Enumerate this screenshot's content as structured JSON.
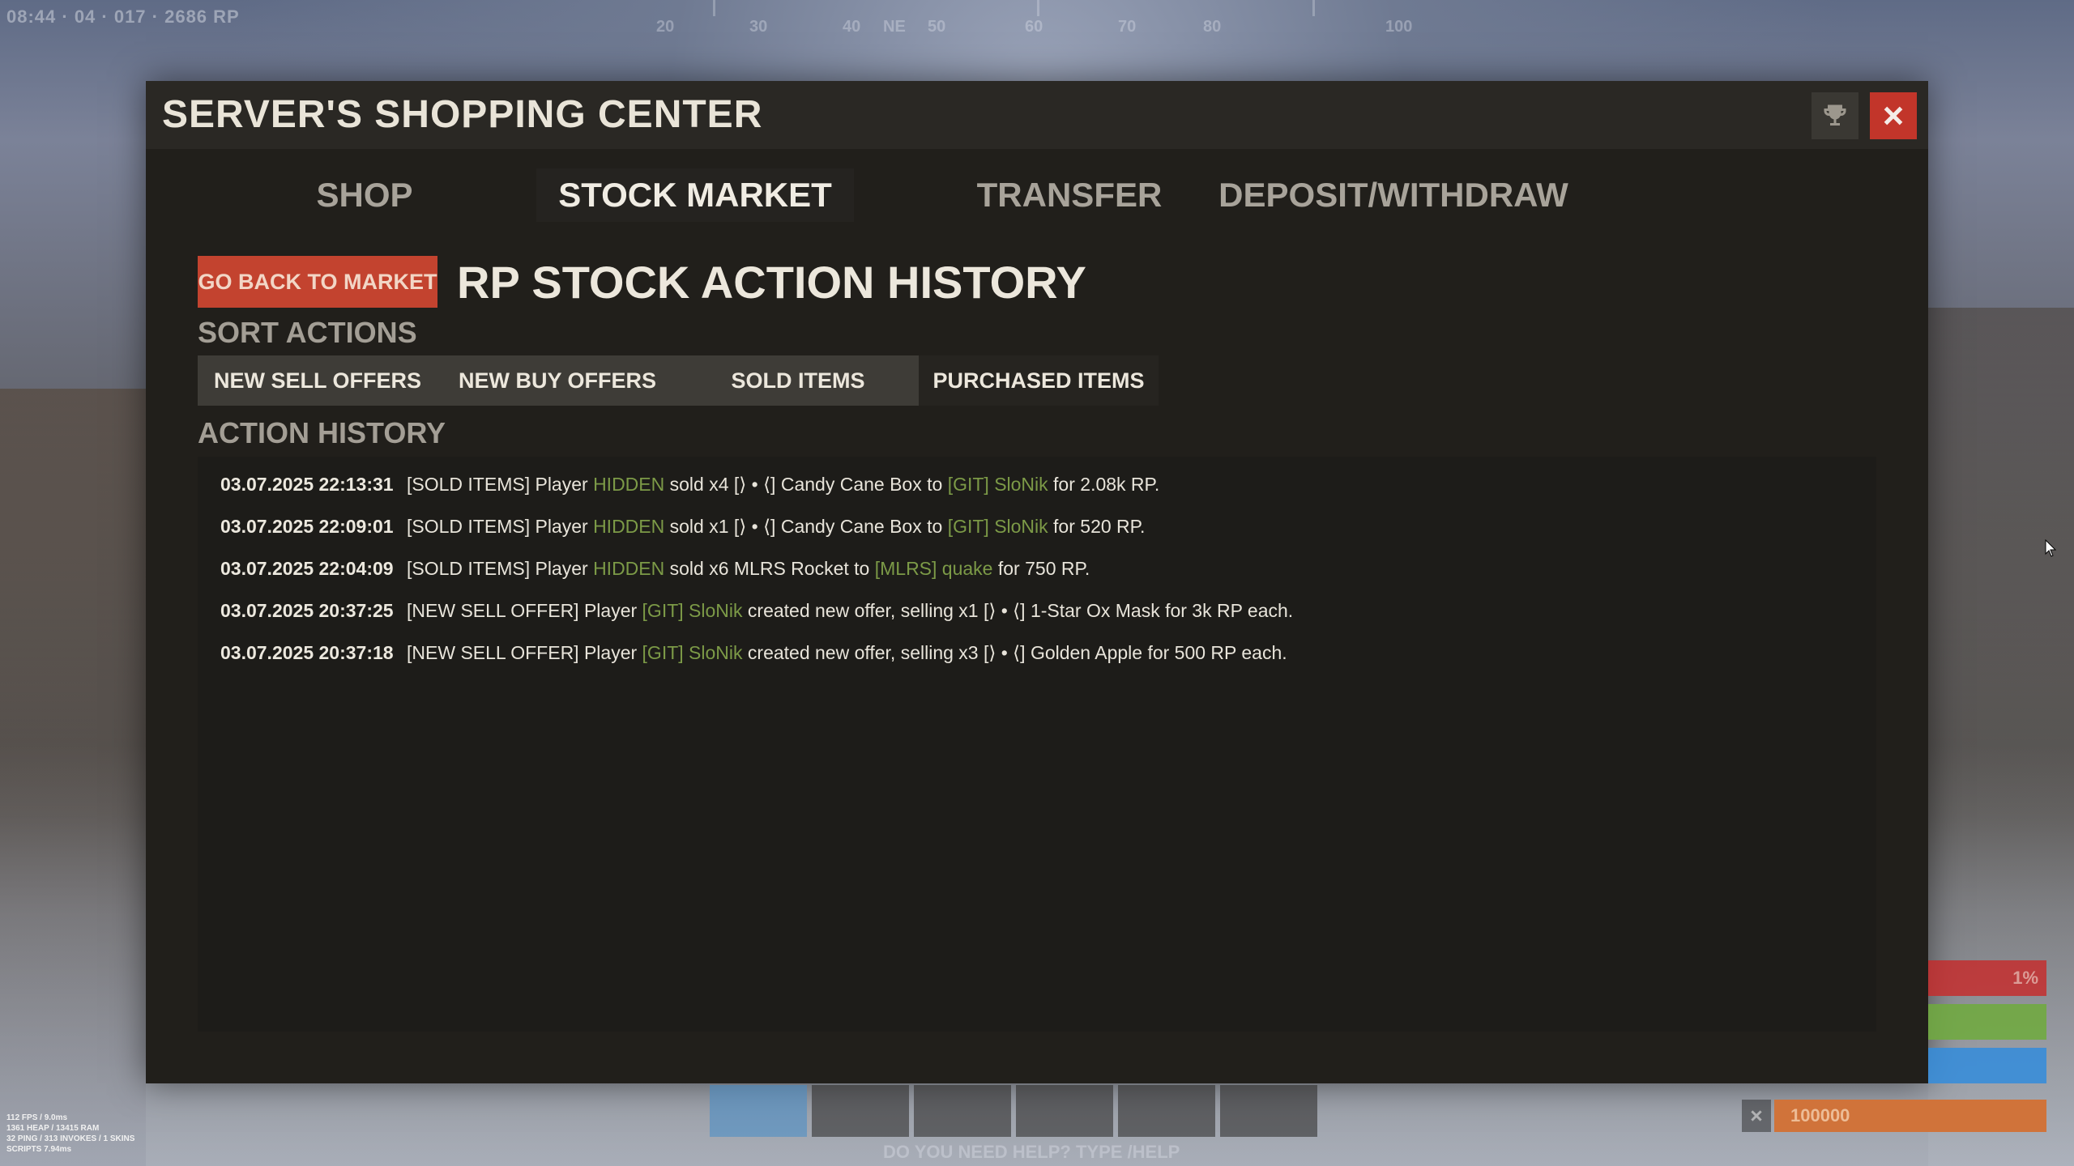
{
  "hud": {
    "top_left": "08:44 · 04 · 017 · 2686 RP",
    "compass": [
      "20",
      "30",
      "40",
      "NE",
      "50",
      "60",
      "70",
      "80",
      "100"
    ],
    "stats": [
      "112 FPS / 9.0ms",
      "1361 HEAP / 13415 RAM",
      "32 PING / 313 INVOKES / 1 SKINS",
      "SCRIPTS 7.94ms"
    ],
    "help_hint": "DO YOU NEED HELP? TYPE /HELP",
    "xp_value": "100000",
    "vital_top": "1%"
  },
  "window": {
    "title": "SERVER'S SHOPPING CENTER"
  },
  "tabs": [
    {
      "label": "SHOP"
    },
    {
      "label": "STOCK MARKET"
    },
    {
      "label": "TRANSFER"
    },
    {
      "label": "DEPOSIT/WITHDRAW"
    }
  ],
  "page": {
    "back_button": "GO BACK TO MARKET",
    "heading": "RP STOCK ACTION HISTORY",
    "sort_label": "SORT ACTIONS",
    "history_label": "ACTION HISTORY"
  },
  "sort_buttons": [
    {
      "label": "NEW SELL OFFERS"
    },
    {
      "label": "NEW BUY OFFERS"
    },
    {
      "label": "SOLD ITEMS"
    },
    {
      "label": "PURCHASED ITEMS"
    }
  ],
  "history": [
    {
      "timestamp": "03.07.2025 22:13:31",
      "parts": [
        {
          "t": "[SOLD ITEMS] Player ",
          "hl": false
        },
        {
          "t": "HIDDEN",
          "hl": true
        },
        {
          "t": " sold x4 [⟩ • ⟨] Candy Cane Box to ",
          "hl": false
        },
        {
          "t": "[GIT] SloNik",
          "hl": true
        },
        {
          "t": " for 2.08k RP.",
          "hl": false
        }
      ]
    },
    {
      "timestamp": "03.07.2025 22:09:01",
      "parts": [
        {
          "t": "[SOLD ITEMS] Player ",
          "hl": false
        },
        {
          "t": "HIDDEN",
          "hl": true
        },
        {
          "t": " sold x1 [⟩ • ⟨] Candy Cane Box to ",
          "hl": false
        },
        {
          "t": "[GIT] SloNik",
          "hl": true
        },
        {
          "t": " for 520 RP.",
          "hl": false
        }
      ]
    },
    {
      "timestamp": "03.07.2025 22:04:09",
      "parts": [
        {
          "t": "[SOLD ITEMS] Player ",
          "hl": false
        },
        {
          "t": "HIDDEN",
          "hl": true
        },
        {
          "t": " sold x6 MLRS Rocket to ",
          "hl": false
        },
        {
          "t": "[MLRS] quake",
          "hl": true
        },
        {
          "t": " for 750 RP.",
          "hl": false
        }
      ]
    },
    {
      "timestamp": "03.07.2025 20:37:25",
      "parts": [
        {
          "t": "[NEW SELL OFFER] Player ",
          "hl": false
        },
        {
          "t": "[GIT] SloNik",
          "hl": true
        },
        {
          "t": " created new offer, selling x1 [⟩ • ⟨] 1-Star Ox Mask for 3k RP each.",
          "hl": false
        }
      ]
    },
    {
      "timestamp": "03.07.2025 20:37:18",
      "parts": [
        {
          "t": "[NEW SELL OFFER] Player ",
          "hl": false
        },
        {
          "t": "[GIT] SloNik",
          "hl": true
        },
        {
          "t": " created new offer, selling x3 [⟩ • ⟨] Golden Apple for 500 RP each.",
          "hl": false
        }
      ]
    }
  ],
  "colors": {
    "highlight": "#7c9a47",
    "close": "#c2352a",
    "back_button": "#c3432f"
  }
}
